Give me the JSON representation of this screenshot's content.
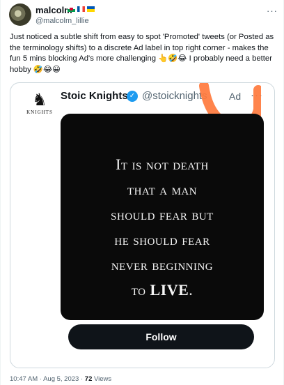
{
  "tweet": {
    "author_name": "malcolm",
    "flags": [
      "wales-flag",
      "france-flag",
      "ukraine-flag"
    ],
    "handle": "@malcolm_lillie",
    "more": "···",
    "text": "Just noticed a subtle shift from easy to spot 'Promoted' tweets (or Posted as the terminology shifts) to a discrete Ad label in top right corner - makes the fun 5 mins blocking Ad's more challenging 👆🤣😂 I probably need a better hobby 🤣😂😀",
    "time": "10:47 AM",
    "date": "Aug 5, 2023",
    "separator": "·",
    "views_count": "72",
    "views_label": "Views"
  },
  "ad_card": {
    "logo_word": "KNIGHTS",
    "logo_piece": "♞",
    "name": "Stoic Knights",
    "verified_icon": "✓",
    "handle": "@stoicknights",
    "ad_label": "Ad",
    "more": "···",
    "quote": {
      "line1": "It is not death",
      "line2": "that a man",
      "line3": "should fear but",
      "line4": "he should fear",
      "line5": "never beginning",
      "line6_prefix": "to ",
      "line6_emph": "LIVE",
      "line6_suffix": "."
    },
    "follow_label": "Follow",
    "highlight_color": "#ff7a3d"
  }
}
